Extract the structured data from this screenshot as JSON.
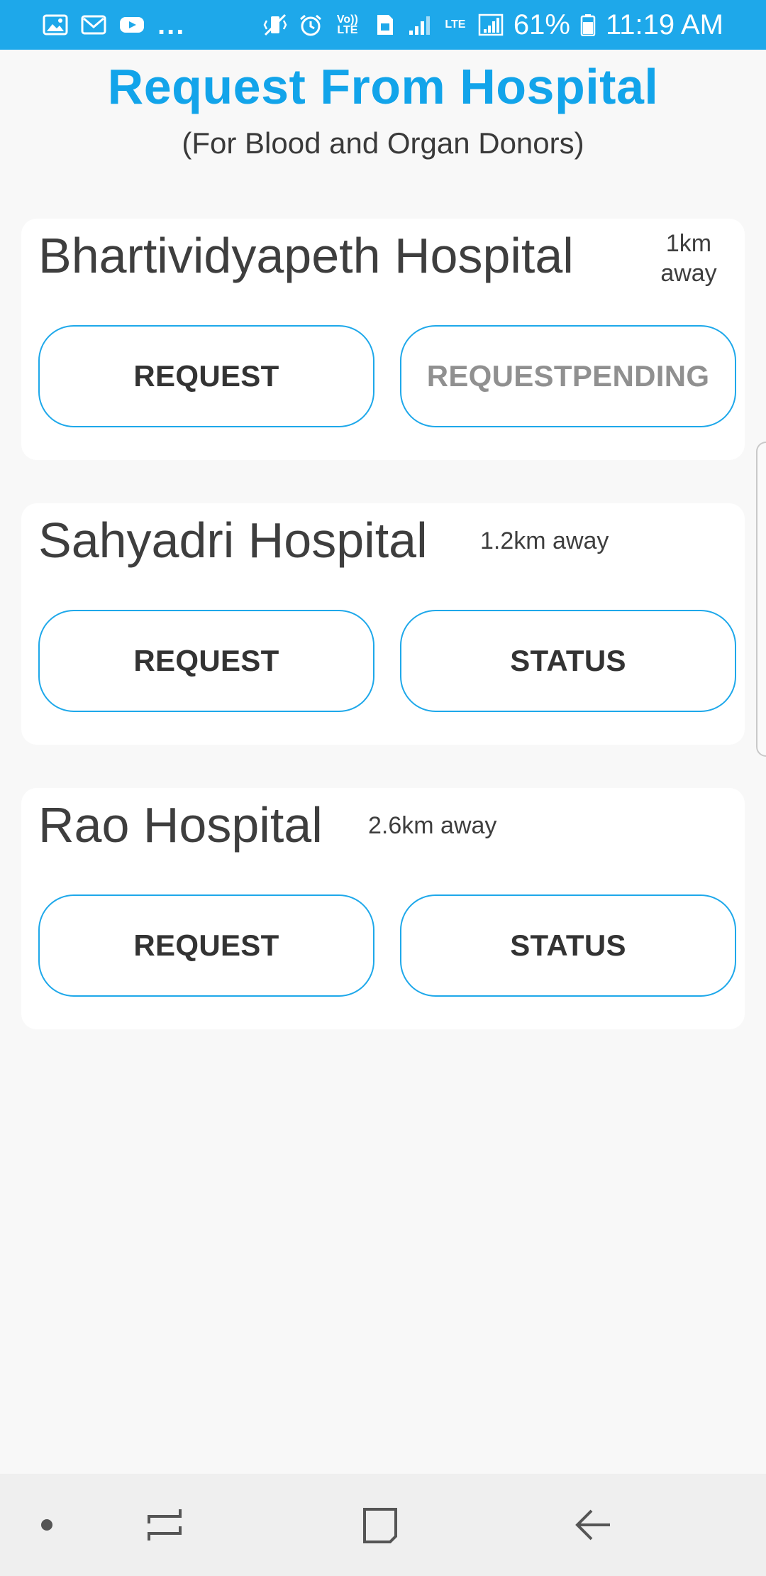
{
  "status_bar": {
    "notification_icons": [
      "gallery-icon",
      "gmail-icon",
      "youtube-icon"
    ],
    "more": "...",
    "volte": "Vo)) LTE",
    "lte": "LTE",
    "battery": "61%",
    "time": "11:19 AM"
  },
  "header": {
    "title": "Request From Hospital",
    "subtitle": "(For Blood and Organ Donors)"
  },
  "hospitals": [
    {
      "name": "Bhartividyapeth Hospital",
      "distance_line1": "1km",
      "distance_line2": "away",
      "left_button": "REQUEST",
      "right_button": "REQUESTPENDING"
    },
    {
      "name": "Sahyadri Hospital",
      "distance": "1.2km away",
      "left_button": "REQUEST",
      "right_button": "STATUS"
    },
    {
      "name": "Rao Hospital",
      "distance": "2.6km away",
      "left_button": "REQUEST",
      "right_button": "STATUS"
    }
  ],
  "colors": {
    "accent": "#12a4ea",
    "status_bar": "#1ea8ea",
    "background": "#f8f8f8",
    "card": "#ffffff",
    "muted_button_text": "#909090"
  },
  "nav_bar": {
    "icons": [
      "dot-icon",
      "recent-apps-icon",
      "home-icon",
      "back-icon"
    ]
  }
}
